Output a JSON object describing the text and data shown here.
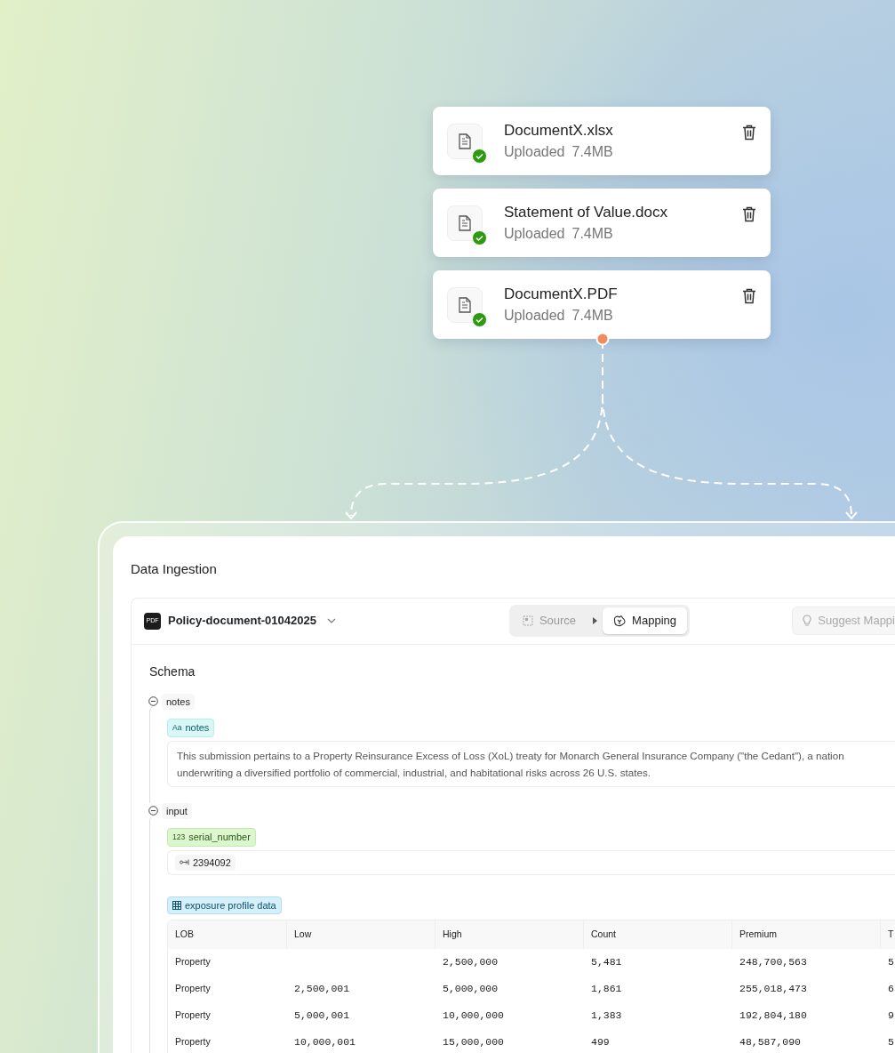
{
  "files": [
    {
      "name": "DocumentX.xlsx",
      "status": "Uploaded",
      "size": "7.4MB",
      "uploaded": true
    },
    {
      "name": "Statement of Value.docx",
      "status": "Uploaded",
      "size": "7.4MB",
      "uploaded": true
    },
    {
      "name": "DocumentX.PDF",
      "status": "Uploaded",
      "size": "7.4MB",
      "uploaded": true
    }
  ],
  "panel": {
    "title": "Data Ingestion",
    "document": {
      "badge": "PDF",
      "name": "Policy-document-01042025"
    },
    "steps": [
      {
        "label": "Source",
        "selected": false
      },
      {
        "label": "Mapping",
        "selected": true
      }
    ],
    "suggest_button": "Suggest Mappi",
    "schema_title": "Schema",
    "groups": [
      {
        "label": "notes",
        "expanded": true,
        "fields": [
          {
            "kind": "text",
            "tag_icon": "Aa",
            "tag": "notes",
            "lines": [
              "This submission pertains to a Property Reinsurance Excess of Loss (XoL) treaty for Monarch General Insurance Company (\"the Cedant\"), a nation",
              "underwriting a diversified portfolio of commercial, industrial, and habitational risks across 26 U.S. states."
            ]
          }
        ]
      },
      {
        "label": "input",
        "expanded": true,
        "fields": [
          {
            "kind": "number",
            "tag_icon": "123",
            "tag": "serial_number",
            "value": "2394092"
          },
          {
            "kind": "table",
            "tag": "exposure profile data",
            "columns": [
              "LOB",
              "Low",
              "High",
              "Count",
              "Premium",
              "T"
            ],
            "rows": [
              [
                "Property",
                "",
                "2,500,000",
                "5,481",
                "248,700,563",
                "5"
              ],
              [
                "Property",
                "2,500,001",
                "5,000,000",
                "1,861",
                "255,018,473",
                "6"
              ],
              [
                "Property",
                "5,000,001",
                "10,000,000",
                "1,383",
                "192,804,180",
                "9"
              ],
              [
                "Property",
                "10,000,001",
                "15,000,000",
                "499",
                "48,587,090",
                "5"
              ]
            ]
          }
        ]
      }
    ]
  }
}
